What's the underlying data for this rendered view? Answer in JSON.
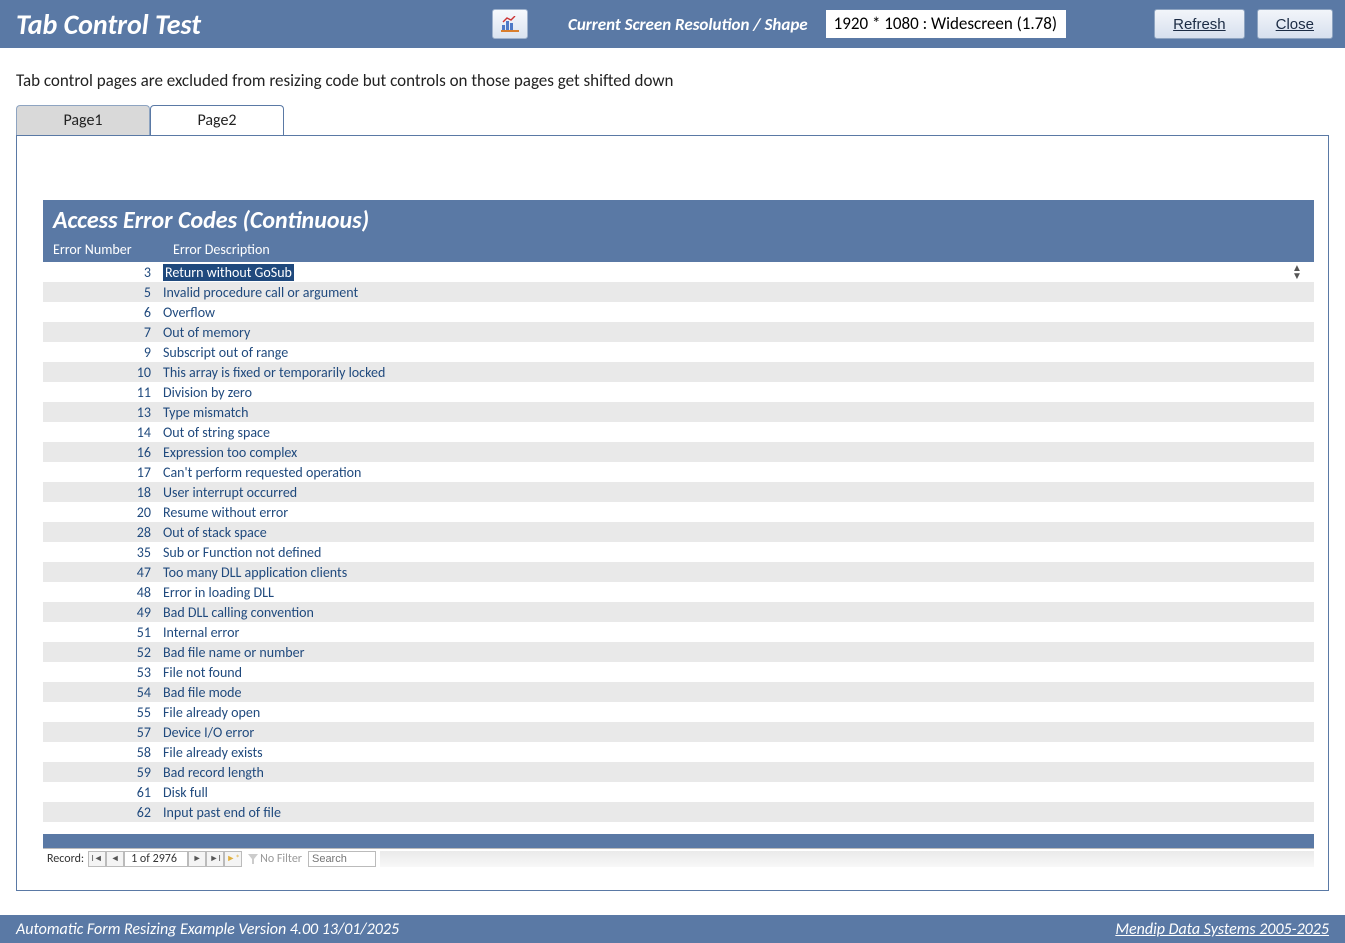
{
  "header": {
    "title": "Tab Control Test",
    "resolution_label": "Current Screen Resolution / Shape",
    "resolution_value": "1920 * 1080 : Widescreen (1.78)",
    "refresh": "Refresh",
    "close": "Close"
  },
  "note": "Tab control pages are excluded from resizing code but controls on those pages get shifted down",
  "tabs": [
    "Page1",
    "Page2"
  ],
  "active_tab": 1,
  "subform": {
    "title": "Access Error Codes (Continuous)",
    "col1": "Error Number",
    "col2": "Error Description",
    "rows": [
      {
        "n": 3,
        "d": "Return without GoSub",
        "sel": true
      },
      {
        "n": 5,
        "d": "Invalid procedure call or argument"
      },
      {
        "n": 6,
        "d": "Overflow"
      },
      {
        "n": 7,
        "d": "Out of memory"
      },
      {
        "n": 9,
        "d": "Subscript out of range"
      },
      {
        "n": 10,
        "d": "This array is fixed or temporarily locked"
      },
      {
        "n": 11,
        "d": "Division by zero"
      },
      {
        "n": 13,
        "d": "Type mismatch"
      },
      {
        "n": 14,
        "d": "Out of string space"
      },
      {
        "n": 16,
        "d": "Expression too complex"
      },
      {
        "n": 17,
        "d": "Can't perform requested operation"
      },
      {
        "n": 18,
        "d": "User interrupt occurred"
      },
      {
        "n": 20,
        "d": "Resume without error"
      },
      {
        "n": 28,
        "d": "Out of stack space"
      },
      {
        "n": 35,
        "d": "Sub or Function not defined"
      },
      {
        "n": 47,
        "d": "Too many DLL application clients"
      },
      {
        "n": 48,
        "d": "Error in loading DLL"
      },
      {
        "n": 49,
        "d": "Bad DLL calling convention"
      },
      {
        "n": 51,
        "d": "Internal error"
      },
      {
        "n": 52,
        "d": "Bad file name or number"
      },
      {
        "n": 53,
        "d": "File not found"
      },
      {
        "n": 54,
        "d": "Bad file mode"
      },
      {
        "n": 55,
        "d": "File already open"
      },
      {
        "n": 57,
        "d": "Device I/O error"
      },
      {
        "n": 58,
        "d": "File already exists"
      },
      {
        "n": 59,
        "d": "Bad record length"
      },
      {
        "n": 61,
        "d": "Disk full"
      },
      {
        "n": 62,
        "d": "Input past end of file"
      }
    ]
  },
  "recnav": {
    "label": "Record:",
    "position": "1 of 2976",
    "nofilter": "No Filter",
    "search": "Search"
  },
  "footer": {
    "left": "Automatic Form Resizing Example   Version 4.00   13/01/2025",
    "right": "Mendip Data Systems 2005-2025"
  }
}
